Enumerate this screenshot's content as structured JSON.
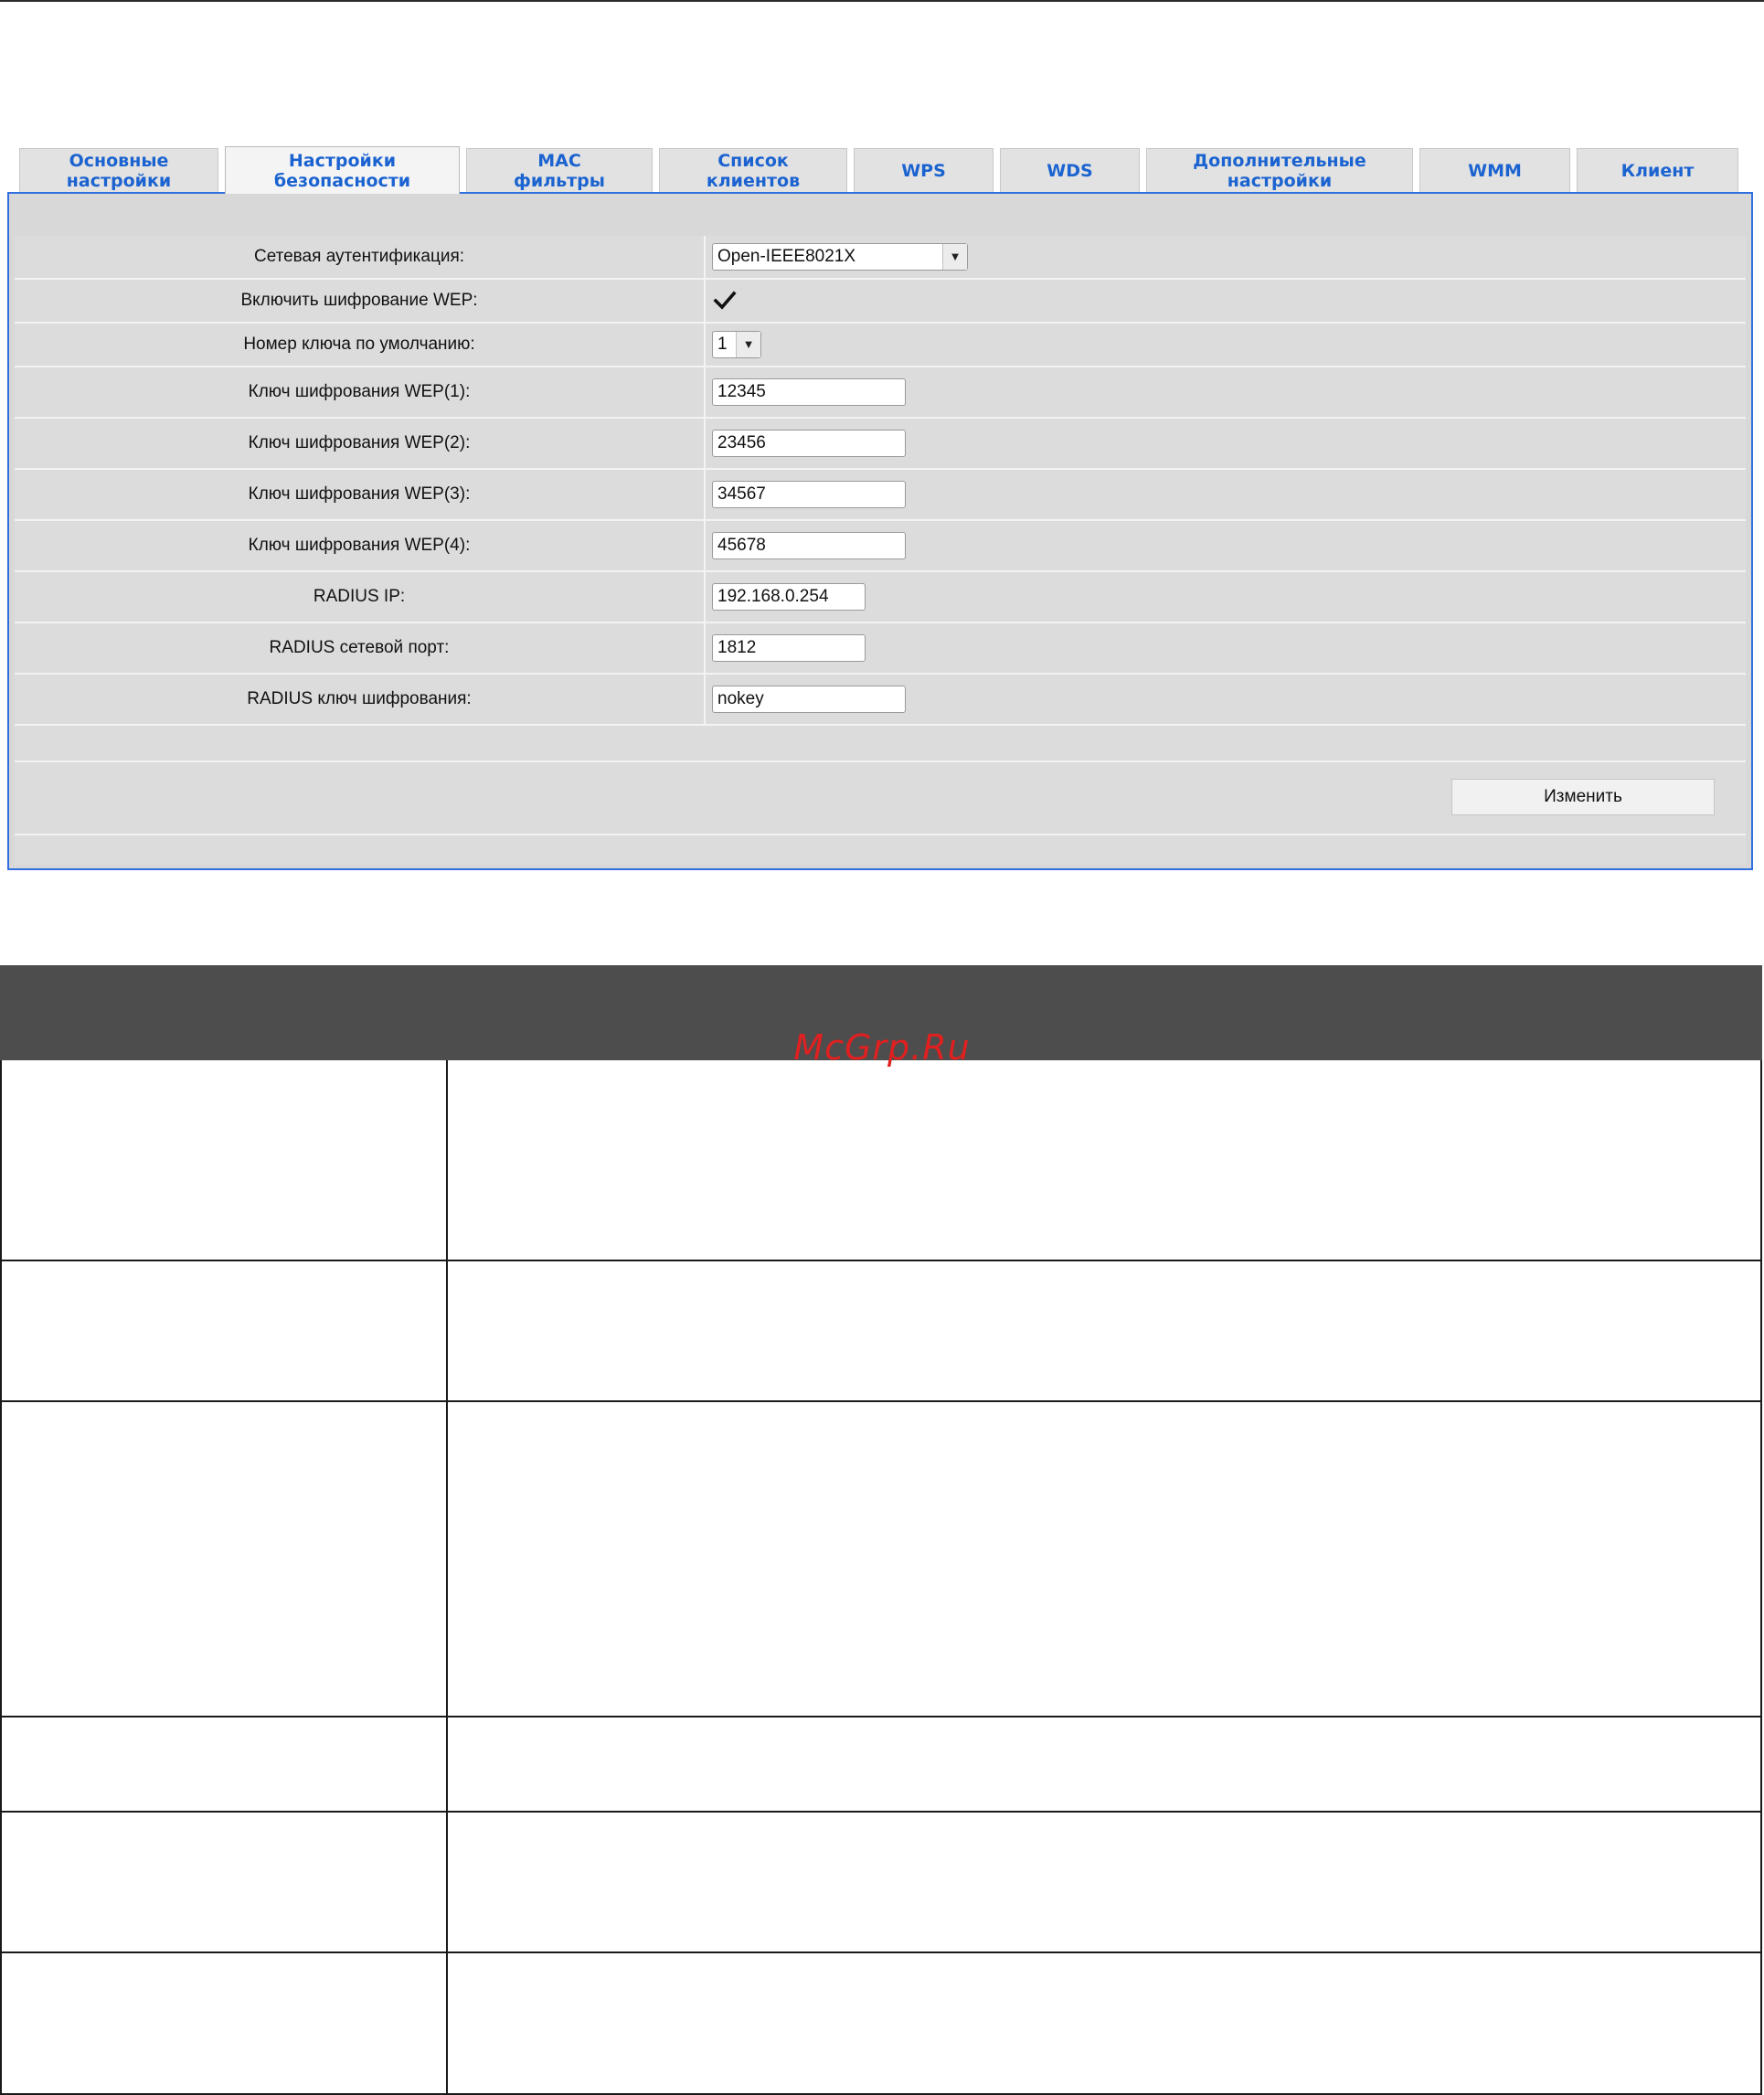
{
  "tabs": [
    {
      "label": "Основные\nнастройки"
    },
    {
      "label": "Настройки\nбезопасности"
    },
    {
      "label": "MAC\nфильтры"
    },
    {
      "label": "Список\nклиентов"
    },
    {
      "label": "WPS"
    },
    {
      "label": "WDS"
    },
    {
      "label": "Дополнительные\nнастройки"
    },
    {
      "label": "WMM"
    },
    {
      "label": "Клиент"
    }
  ],
  "active_tab": "Настройки\nбезопасности",
  "form": {
    "auth": {
      "label": "Сетевая аутентификация:",
      "value": "Open-IEEE8021X"
    },
    "wep_enable": {
      "label": "Включить шифрование WEP:",
      "checked": true
    },
    "default_key": {
      "label": "Номер ключа по умолчанию:",
      "value": "1"
    },
    "wep1": {
      "label": "Ключ шифрования WEP(1):",
      "value": "12345"
    },
    "wep2": {
      "label": "Ключ шифрования WEP(2):",
      "value": "23456"
    },
    "wep3": {
      "label": "Ключ шифрования WEP(3):",
      "value": "34567"
    },
    "wep4": {
      "label": "Ключ шифрования WEP(4):",
      "value": "45678"
    },
    "radius_ip": {
      "label": "RADIUS IP:",
      "value": "192.168.0.254"
    },
    "radius_port": {
      "label": "RADIUS сетевой порт:",
      "value": "1812"
    },
    "radius_key": {
      "label": "RADIUS ключ шифрования:",
      "value": "nokey"
    },
    "submit_label": "Изменить"
  },
  "watermark": "McGrp.Ru",
  "colors": {
    "tab_text": "#1b63d0",
    "panel_border": "#2f6fe0",
    "table_header": "#4d4d4d",
    "watermark": "#e02020"
  }
}
